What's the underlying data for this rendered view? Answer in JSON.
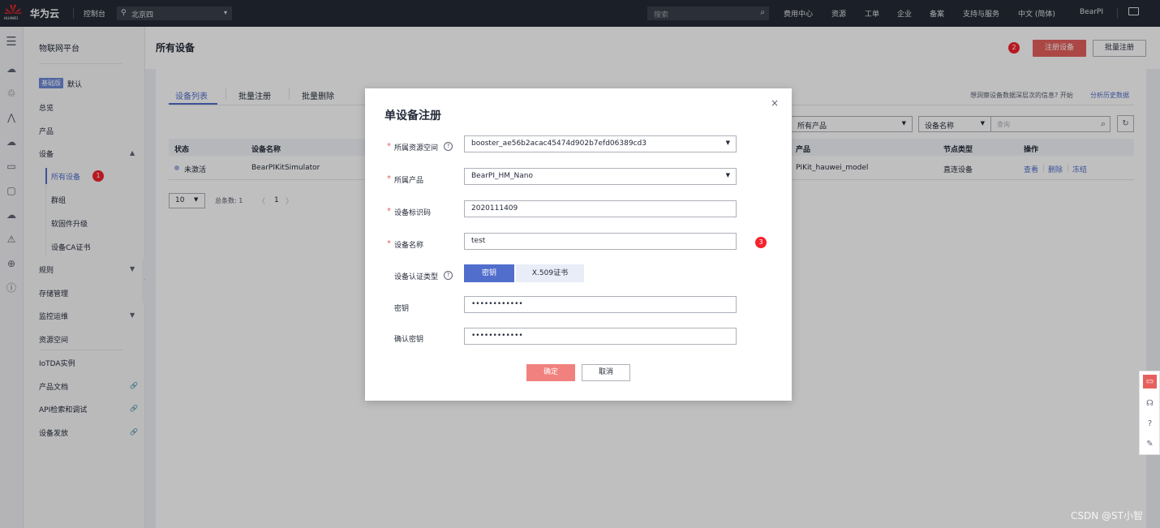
{
  "topbar": {
    "logo_text": "HUAWEI",
    "brand": "华为云",
    "console": "控制台",
    "region": "北京四",
    "search_placeholder": "搜索",
    "nav": [
      "费用中心",
      "资源",
      "工单",
      "企业",
      "备案",
      "支持与服务",
      "中文 (简体)",
      "BearPI"
    ]
  },
  "sidebar": {
    "title": "物联网平台",
    "edition": "基础版",
    "default": "默认",
    "items": {
      "overview": "总览",
      "product": "产品",
      "device": "设备",
      "all_devices": "所有设备",
      "group": "群组",
      "firmware": "软固件升级",
      "ca_cert": "设备CA证书",
      "rules": "规则",
      "storage": "存储管理",
      "monitor": "监控运维",
      "resource_space": "资源空间",
      "iotda": "IoTDA实例",
      "docs": "产品文档",
      "api": "API检索和调试",
      "provision": "设备发放"
    }
  },
  "markers": {
    "m1": "1",
    "m2": "2",
    "m3": "3"
  },
  "page": {
    "title": "所有设备",
    "register_btn": "注册设备",
    "batch_btn": "批量注册",
    "tabs": [
      "设备列表",
      "批量注册",
      "批量删除"
    ],
    "hint": "想洞察设备数据深层次的信息? 开始",
    "hint_link": "分析历史数据",
    "filter_product": "所有产品",
    "filter_field": "设备名称",
    "filter_placeholder": "查询",
    "table": {
      "headers": [
        "状态",
        "设备名称",
        "产品",
        "节点类型",
        "操作"
      ],
      "row": {
        "status": "未激活",
        "name": "BearPIKitSimulator",
        "product": "PIKit_hauwei_model",
        "node_type": "直连设备",
        "ops": [
          "查看",
          "删除",
          "冻结"
        ]
      }
    },
    "pager": {
      "size": "10",
      "total": "总条数: 1",
      "current": "1",
      "prev": "〈",
      "next": "〉"
    }
  },
  "dialog": {
    "title": "单设备注册",
    "close": "×",
    "fields": {
      "resource_space": {
        "label": "所属资源空间",
        "value": "booster_ae56b2acac45474d902b7efd06389cd3"
      },
      "product": {
        "label": "所属产品",
        "value": "BearPI_HM_Nano"
      },
      "identifier": {
        "label": "设备标识码",
        "value": "2020111409"
      },
      "name": {
        "label": "设备名称",
        "value": "test"
      },
      "auth_type": {
        "label": "设备认证类型",
        "options": [
          "密钥",
          "X.509证书"
        ],
        "selected": "密钥"
      },
      "secret": {
        "label": "密钥",
        "value": "••••••••••••"
      },
      "confirm_secret": {
        "label": "确认密钥",
        "value": "••••••••••••"
      }
    },
    "ok": "确定",
    "cancel": "取消"
  },
  "watermark": "CSDN @ST小智",
  "colors": {
    "accent": "#526ecc",
    "danger": "#e5605d",
    "topbar": "#252a34"
  }
}
